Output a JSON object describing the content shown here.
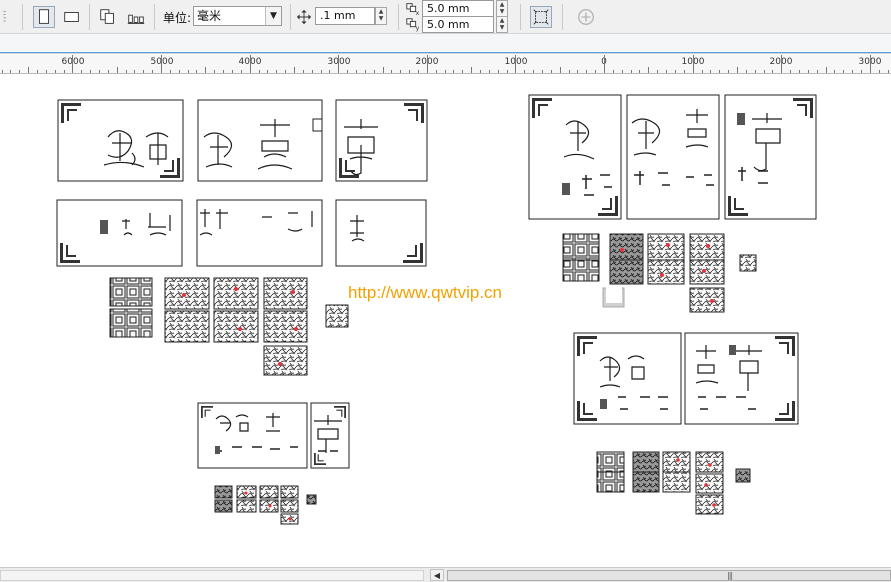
{
  "toolbar": {
    "units_label": "单位:",
    "units_value": "毫米",
    "nudge_value": ".1 mm",
    "dup_x_value": "5.0 mm",
    "dup_y_value": "5.0 mm",
    "icons": [
      "portrait-page-icon",
      "landscape-page-icon",
      "all-pages-icon",
      "current-page-icon",
      "nudge-icon",
      "duplicate-x-icon",
      "duplicate-y-icon",
      "treat-as-filled-icon",
      "add-icon"
    ]
  },
  "ruler": {
    "labels": [
      "6000",
      "5000",
      "4000",
      "3000",
      "2000",
      "1000",
      "0",
      "1000",
      "2000",
      "3000"
    ]
  },
  "canvas": {
    "watermark": "http://www.qwtvip.cn"
  },
  "colors": {
    "watermark": "#f2a200",
    "accent_line": "#5aa0d8",
    "red_mark": "#e8323a"
  }
}
